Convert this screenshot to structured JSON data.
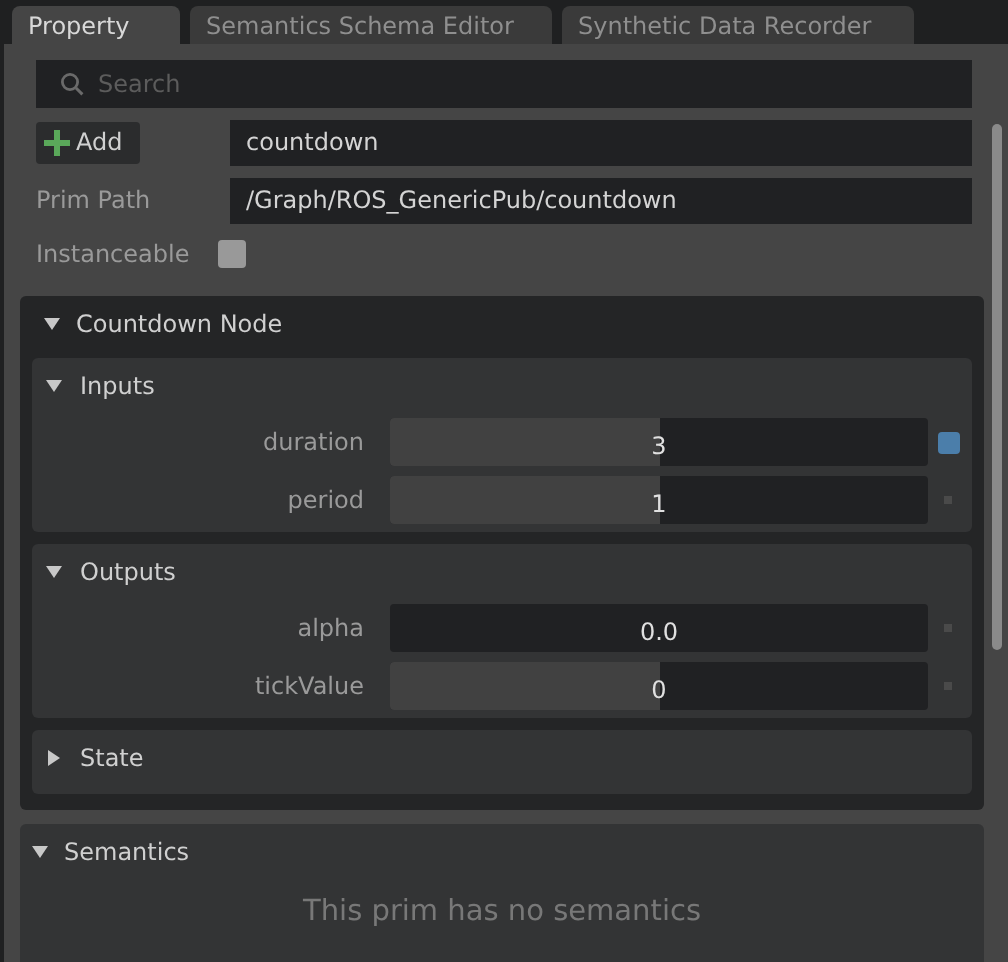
{
  "tabs": [
    {
      "label": "Property",
      "selected": true
    },
    {
      "label": "Semantics Schema Editor",
      "selected": false
    },
    {
      "label": "Synthetic Data Recorder",
      "selected": false
    }
  ],
  "search": {
    "placeholder": "Search"
  },
  "add_button": {
    "label": "Add"
  },
  "name_field": {
    "value": "countdown"
  },
  "prim_path": {
    "label": "Prim Path",
    "value": "/Graph/ROS_GenericPub/countdown"
  },
  "instanceable": {
    "label": "Instanceable",
    "checked": false
  },
  "node": {
    "title": "Countdown Node",
    "expanded": true,
    "groups": [
      {
        "title": "Inputs",
        "expanded": true,
        "fields": [
          {
            "label": "duration",
            "value": "3",
            "level": 0.5,
            "modified": true
          },
          {
            "label": "period",
            "value": "1",
            "level": 0.5,
            "modified": false
          }
        ]
      },
      {
        "title": "Outputs",
        "expanded": true,
        "fields": [
          {
            "label": "alpha",
            "value": "0.0",
            "modified": false
          },
          {
            "label": "tickValue",
            "value": "0",
            "level": 0.5,
            "modified": false
          }
        ]
      },
      {
        "title": "State",
        "expanded": false
      }
    ]
  },
  "semantics": {
    "title": "Semantics",
    "expanded": true,
    "message": "This prim has no semantics"
  }
}
